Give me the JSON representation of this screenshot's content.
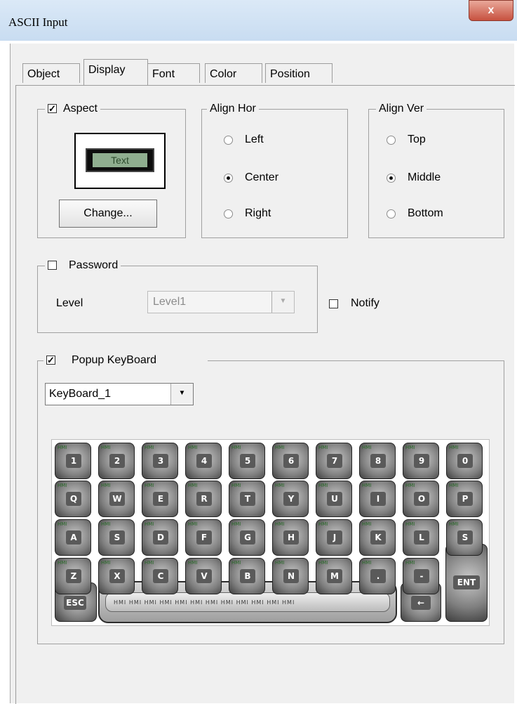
{
  "window": {
    "title": "ASCII Input",
    "close_label": "x"
  },
  "tabs": [
    {
      "label": "Object"
    },
    {
      "label": "Display"
    },
    {
      "label": "Font"
    },
    {
      "label": "Color"
    },
    {
      "label": "Position"
    }
  ],
  "aspect": {
    "label": "Aspect",
    "checked": true,
    "preview_text": "Text",
    "change_button": "Change..."
  },
  "align_hor": {
    "title": "Align Hor",
    "options": [
      "Left",
      "Center",
      "Right"
    ],
    "selected": "Center"
  },
  "align_ver": {
    "title": "Align Ver",
    "options": [
      "Top",
      "Middle",
      "Bottom"
    ],
    "selected": "Middle"
  },
  "password": {
    "label": "Password",
    "checked": false,
    "level_label": "Level",
    "level_value": "Level1"
  },
  "notify": {
    "label": "Notify",
    "checked": false
  },
  "popup_keyboard": {
    "label": "Popup KeyBoard",
    "checked": true,
    "selected": "KeyBoard_1"
  },
  "keyboard": {
    "rows": [
      [
        "1",
        "2",
        "3",
        "4",
        "5",
        "6",
        "7",
        "8",
        "9",
        "0"
      ],
      [
        "Q",
        "W",
        "E",
        "R",
        "T",
        "Y",
        "U",
        "I",
        "O",
        "P"
      ],
      [
        "A",
        "S",
        "D",
        "F",
        "G",
        "H",
        "J",
        "K",
        "L",
        "S"
      ],
      [
        "Z",
        "X",
        "C",
        "V",
        "B",
        "N",
        "M",
        ".",
        "-"
      ]
    ],
    "esc_label": "ESC",
    "ent_label": "ENT",
    "backspace_label": "←",
    "hmi_label": "HMI"
  }
}
